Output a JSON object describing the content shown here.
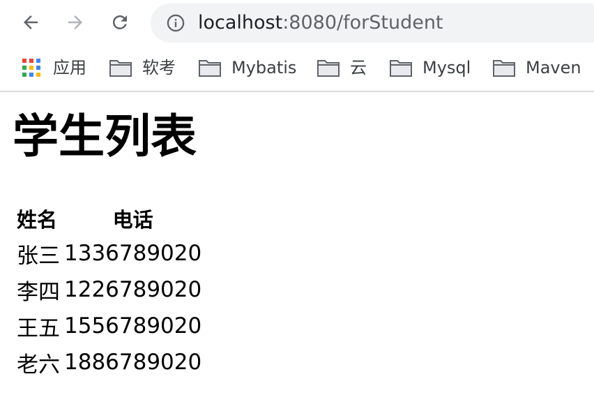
{
  "browser": {
    "url_host": "localhost",
    "url_rest": ":8080/forStudent"
  },
  "bookmarks": [
    {
      "label": "应用",
      "icon": "apps-grid-icon"
    },
    {
      "label": "软考",
      "icon": "folder-icon"
    },
    {
      "label": "Mybatis",
      "icon": "folder-icon"
    },
    {
      "label": "云",
      "icon": "folder-icon"
    },
    {
      "label": "Mysql",
      "icon": "folder-icon"
    },
    {
      "label": "Maven",
      "icon": "folder-icon"
    }
  ],
  "page": {
    "title": "学生列表",
    "table": {
      "headers": [
        "姓名",
        "电话"
      ],
      "rows": [
        [
          "张三",
          "1336789020"
        ],
        [
          "李四",
          "1226789020"
        ],
        [
          "王五",
          "1556789020"
        ],
        [
          "老六",
          "1886789020"
        ]
      ]
    }
  },
  "colors": {
    "omnibox_bg": "#f1f3f4",
    "icon_dark": "#5f6368",
    "icon_disabled": "#b0b3b7"
  }
}
